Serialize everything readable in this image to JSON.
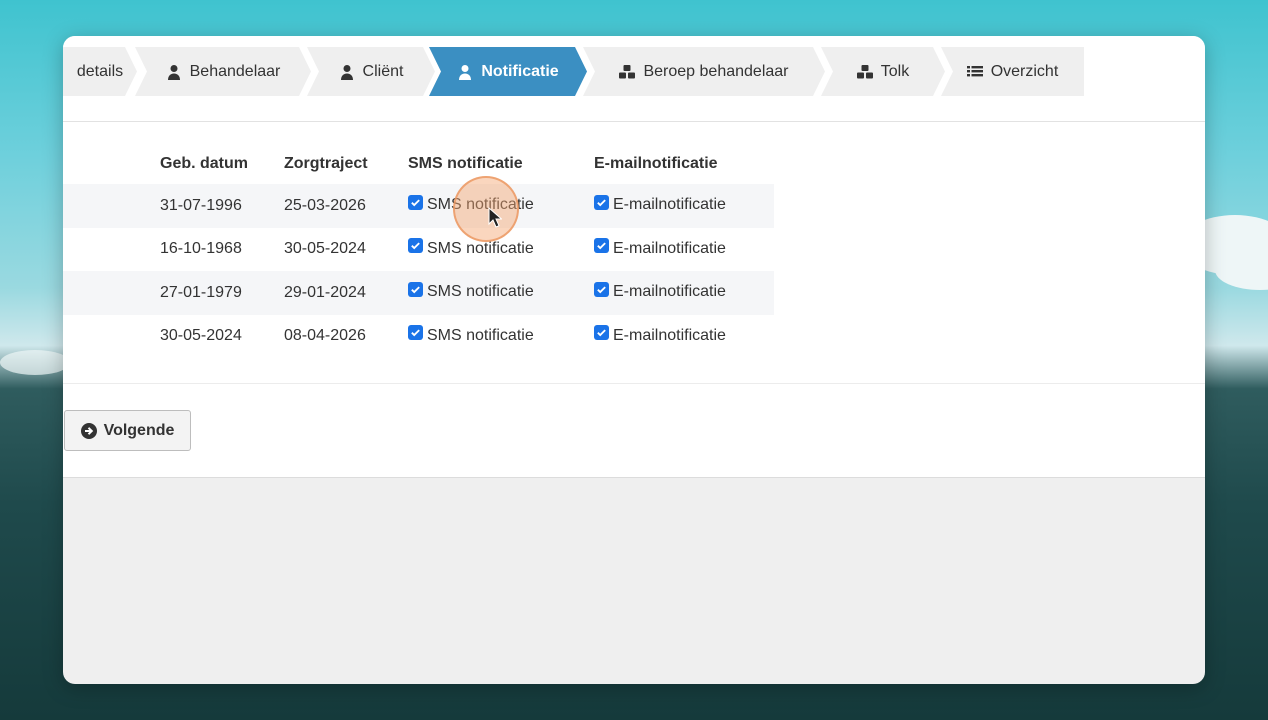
{
  "steps": [
    {
      "label": "details",
      "icon": "none",
      "state": "done"
    },
    {
      "label": "Behandelaar",
      "icon": "user-icon",
      "state": "done"
    },
    {
      "label": "Cliënt",
      "icon": "user-icon",
      "state": "done"
    },
    {
      "label": "Notificatie",
      "icon": "user-icon",
      "state": "active"
    },
    {
      "label": "Beroep behandelaar",
      "icon": "cubes-icon",
      "state": "todo"
    },
    {
      "label": "Tolk",
      "icon": "cubes-icon",
      "state": "todo"
    },
    {
      "label": "Overzicht",
      "icon": "list-icon",
      "state": "todo"
    }
  ],
  "table": {
    "headers": [
      "",
      "Geb. datum",
      "Zorgtraject",
      "SMS notificatie",
      "E-mailnotificatie"
    ],
    "rows": [
      {
        "geb_datum": "31-07-1996",
        "zorgtraject": "25-03-2026",
        "sms_label": "SMS notificatie",
        "sms_checked": true,
        "email_label": "E-mailnotificatie",
        "email_checked": true
      },
      {
        "geb_datum": "16-10-1968",
        "zorgtraject": "30-05-2024",
        "sms_label": "SMS notificatie",
        "sms_checked": true,
        "email_label": "E-mailnotificatie",
        "email_checked": true
      },
      {
        "geb_datum": "27-01-1979",
        "zorgtraject": "29-01-2024",
        "sms_label": "SMS notificatie",
        "sms_checked": true,
        "email_label": "E-mailnotificatie",
        "email_checked": true
      },
      {
        "geb_datum": "30-05-2024",
        "zorgtraject": "08-04-2026",
        "sms_label": "SMS notificatie",
        "sms_checked": true,
        "email_label": "E-mailnotificatie",
        "email_checked": true
      }
    ]
  },
  "actions": {
    "next_label": "Volgende",
    "next_icon": "arrow-circle-right-icon"
  },
  "colors": {
    "active_step": "#3b8fc2",
    "checkbox": "#1a73e8",
    "cursor_highlight": "#f4a46e"
  }
}
